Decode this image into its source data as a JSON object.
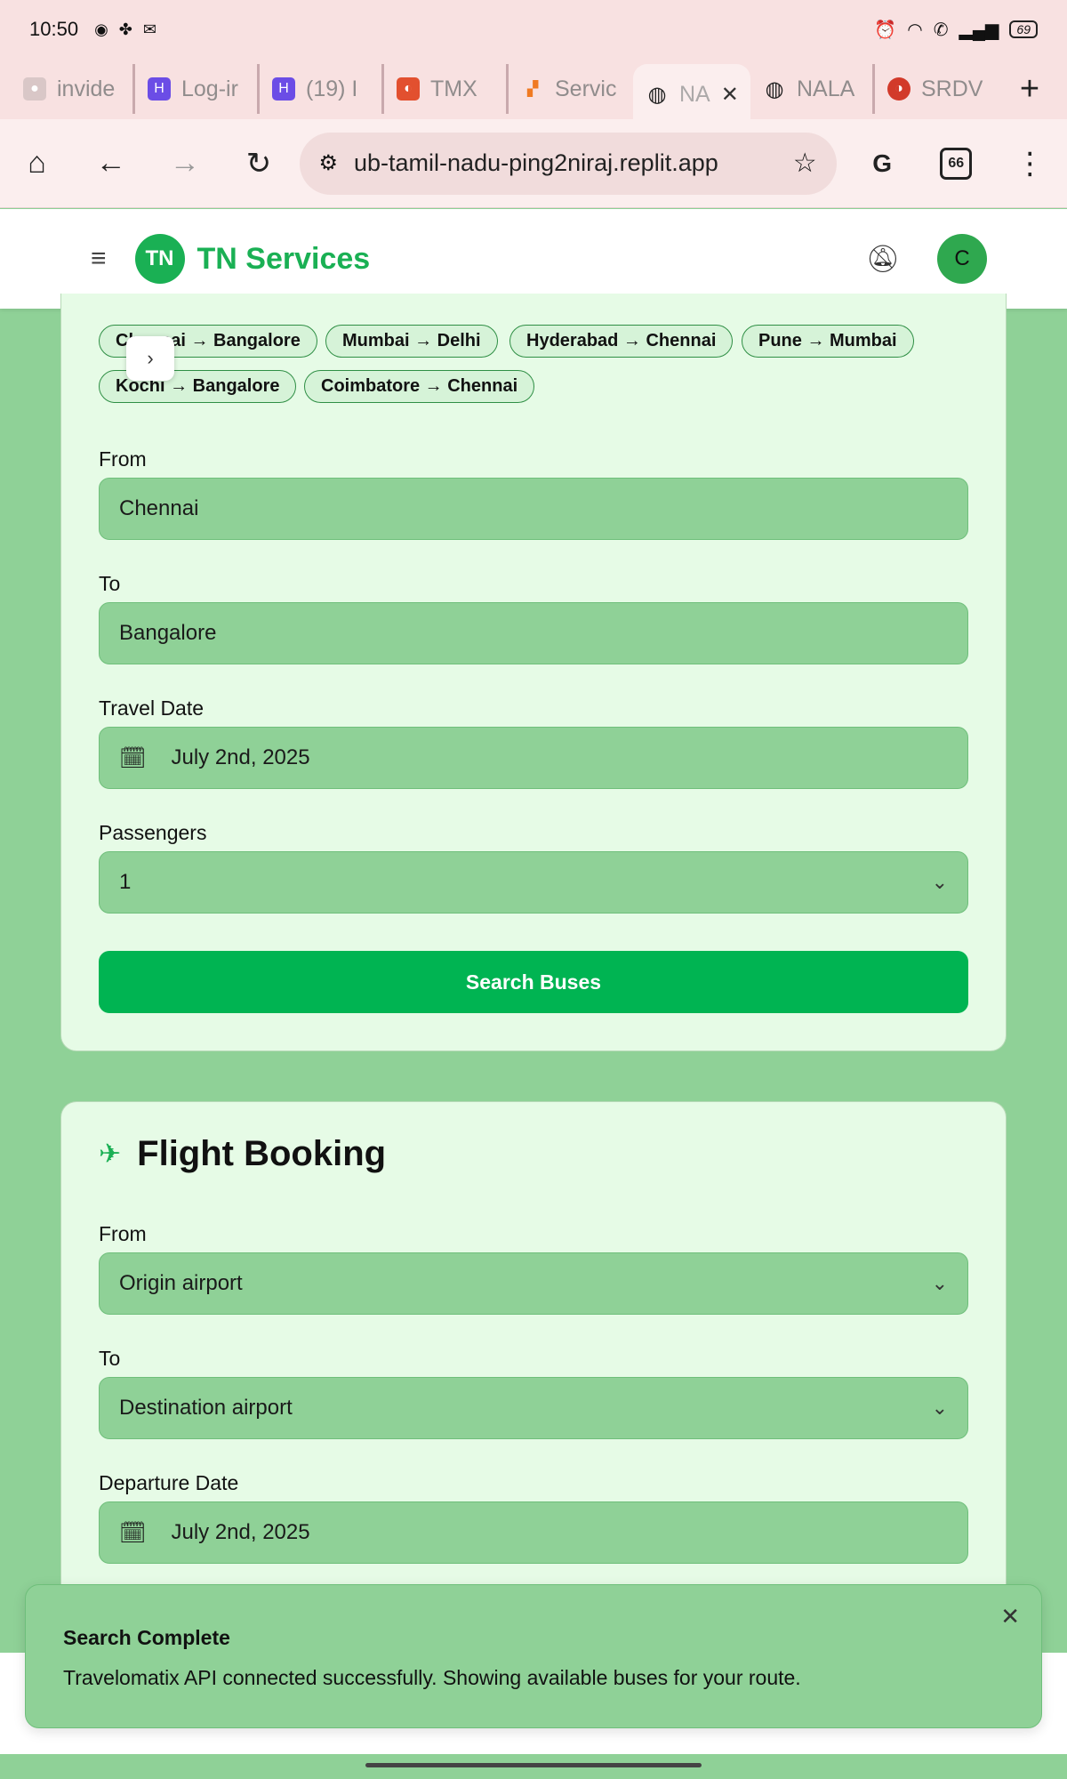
{
  "status_bar": {
    "time": "10:50",
    "battery": "69"
  },
  "tabs": [
    {
      "title": "invide",
      "icon": "ghost-icon",
      "color": "#d9c7c7"
    },
    {
      "title": "Log-ir",
      "icon": "h-logo-icon",
      "color": "#6b4de6"
    },
    {
      "title": "(19) I",
      "icon": "h-logo-icon",
      "color": "#6b4de6"
    },
    {
      "title": "TMX",
      "icon": "tmx-icon",
      "color": "#e2502f"
    },
    {
      "title": "Servic",
      "icon": "puzzle-icon",
      "color": "#f07a22"
    },
    {
      "title": "NA",
      "icon": "globe-icon",
      "color": "#222222",
      "active": true
    },
    {
      "title": "NALA",
      "icon": "globe-icon",
      "color": "#222222"
    },
    {
      "title": "SRDV",
      "icon": "srdv-icon",
      "color": "#d23a2a"
    }
  ],
  "browser": {
    "url": "ub-tamil-nadu-ping2niraj.replit.app",
    "tab_count": "66"
  },
  "app": {
    "logo": "TN",
    "name": "TN Services",
    "avatar": "C",
    "brand_color": "#1ab054"
  },
  "bus": {
    "popular_routes": [
      "Chennai → Bangalore",
      "Mumbai → Delhi",
      "Hyderabad → Chennai",
      "Pune → Mumbai",
      "Kochi → Bangalore",
      "Coimbatore → Chennai"
    ],
    "from_label": "From",
    "from_value": "Chennai",
    "to_label": "To",
    "to_value": "Bangalore",
    "date_label": "Travel Date",
    "date_value": "July 2nd, 2025",
    "passengers_label": "Passengers",
    "passengers_value": "1",
    "search_label": "Search Buses"
  },
  "flight": {
    "title": "Flight Booking",
    "from_label": "From",
    "from_placeholder": "Origin airport",
    "to_label": "To",
    "to_placeholder": "Destination airport",
    "date_label": "Departure Date",
    "date_value": "July 2nd, 2025"
  },
  "toast": {
    "title": "Search Complete",
    "message": "Travelomatix API connected successfully. Showing available buses for your route."
  }
}
